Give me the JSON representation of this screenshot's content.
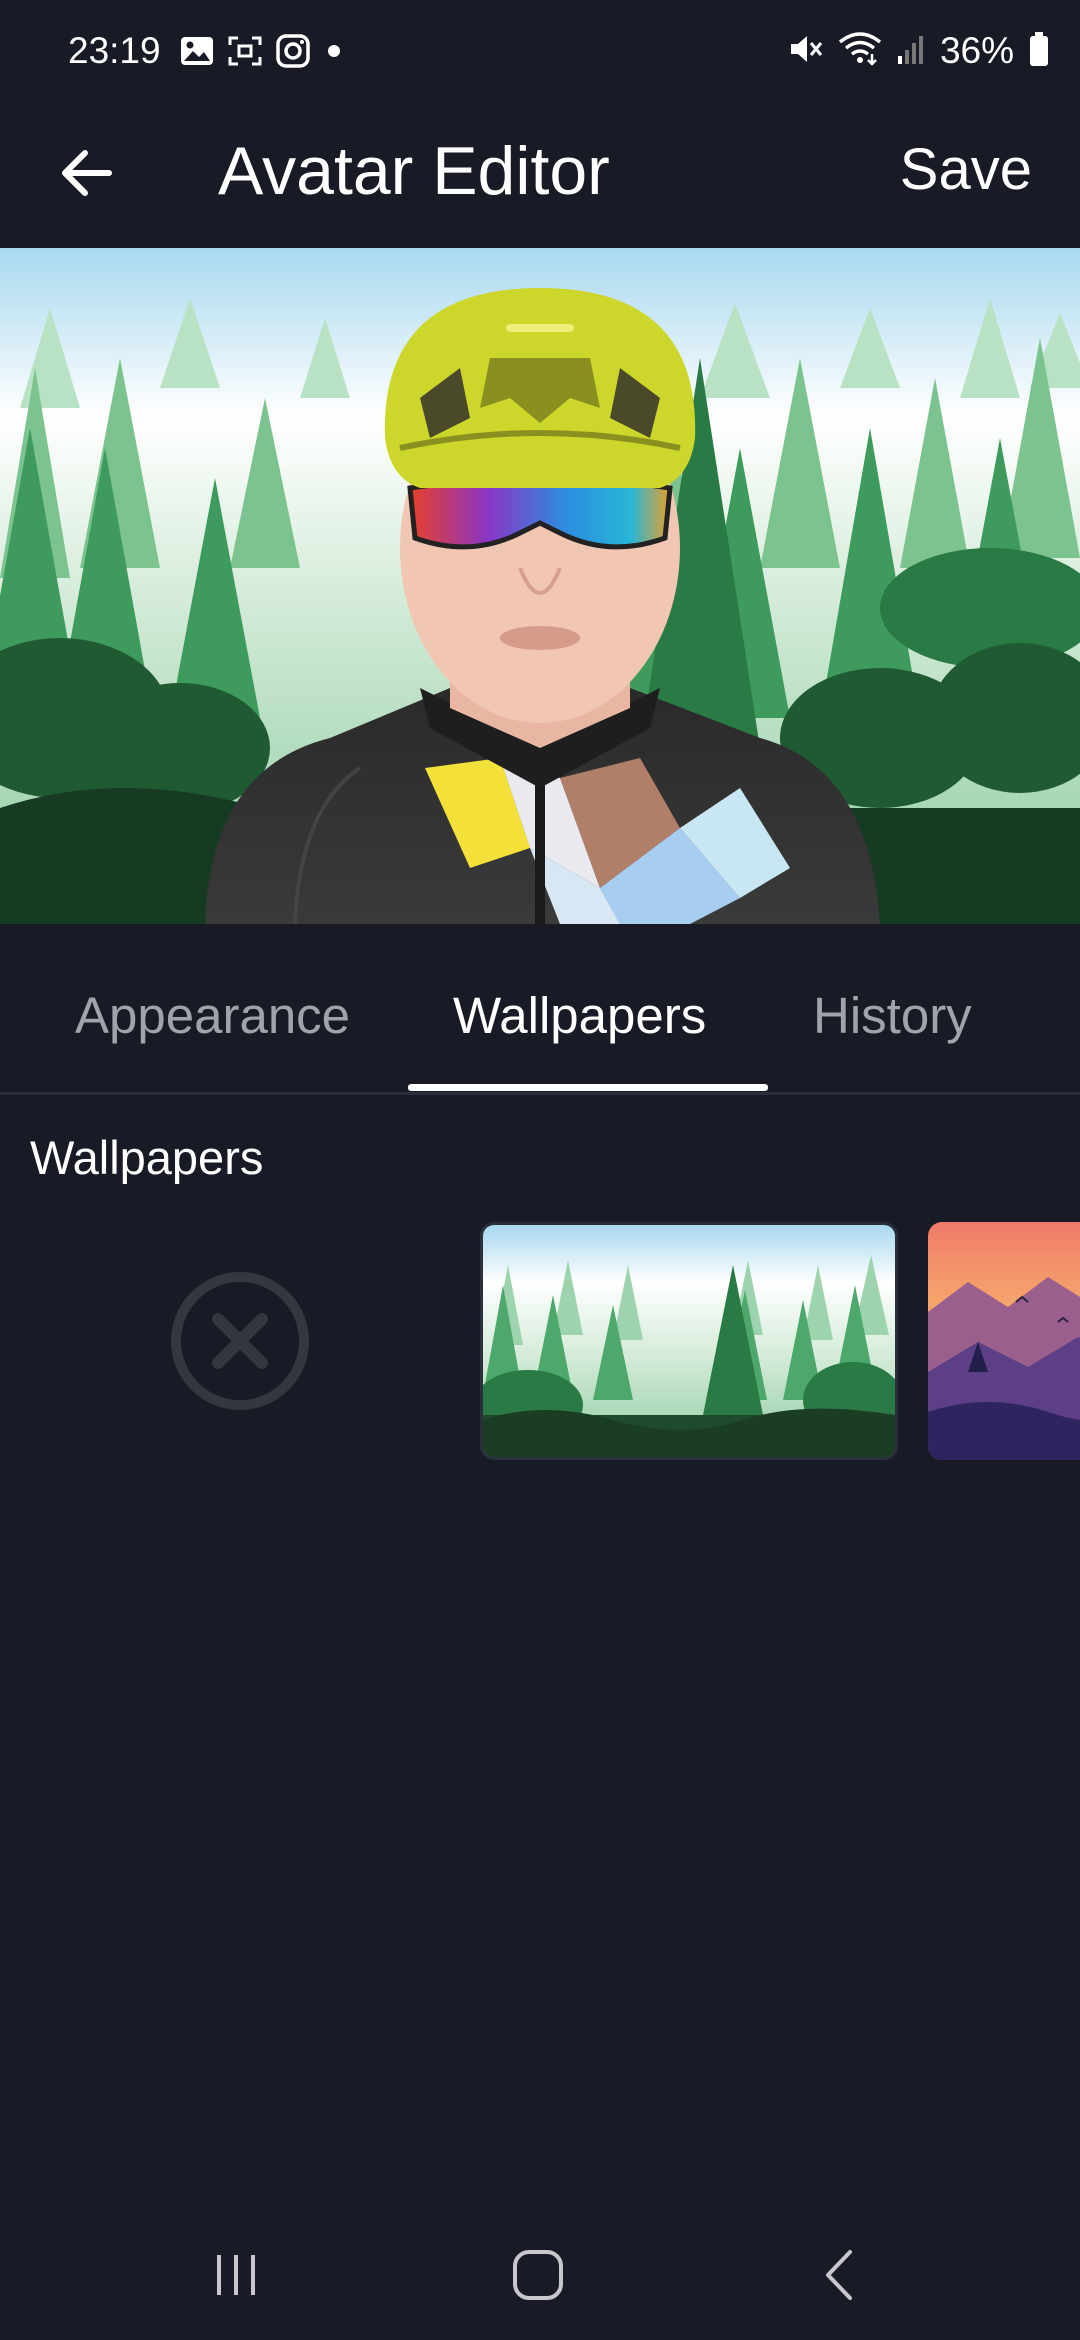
{
  "status_bar": {
    "time": "23:19",
    "battery_percent": "36%",
    "left_icons": [
      "gallery-icon",
      "screenshot-icon",
      "instagram-icon",
      "dot-icon"
    ],
    "right_icons": [
      "mute-icon",
      "wifi-icon",
      "signal-icon",
      "battery-icon"
    ]
  },
  "app_bar": {
    "title": "Avatar Editor",
    "save_label": "Save"
  },
  "tabs": [
    {
      "label": "Appearance",
      "active": false
    },
    {
      "label": "Wallpapers",
      "active": true
    },
    {
      "label": "History",
      "active": false
    }
  ],
  "wallpapers": {
    "section_title": "Wallpapers",
    "options": [
      "none",
      "forest",
      "sunset"
    ]
  },
  "colors": {
    "background": "#181b25",
    "active_tab": "#ffffff",
    "inactive_tab": "#9fa3ab",
    "divider": "#2b2f3c"
  }
}
